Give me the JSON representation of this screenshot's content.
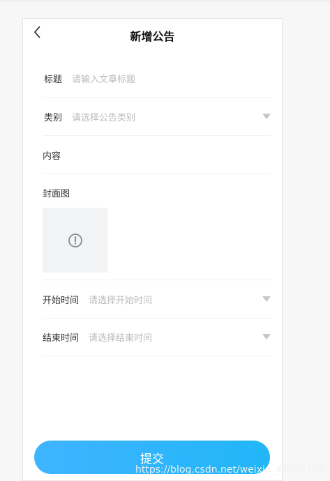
{
  "header": {
    "title": "新增公告"
  },
  "form": {
    "title_label": "标题",
    "title_placeholder": "请输入文章标题",
    "category_label": "类别",
    "category_placeholder": "请选择公告类别",
    "content_label": "内容",
    "cover_label": "封面图",
    "start_label": "开始时间",
    "start_placeholder": "请选择开始时间",
    "end_label": "结束时间",
    "end_placeholder": "请选择结束时间"
  },
  "submit_label": "提交",
  "watermark": "https://blog.csdn.net/weixin_43392489",
  "colors": {
    "accent": "#2cb5fa",
    "placeholder": "#bbbbbb",
    "caret": "#c7c7c7"
  },
  "icons": {
    "back": "chevron-left-icon",
    "upload": "exclamation-circle-icon",
    "dropdown": "caret-down-icon"
  }
}
